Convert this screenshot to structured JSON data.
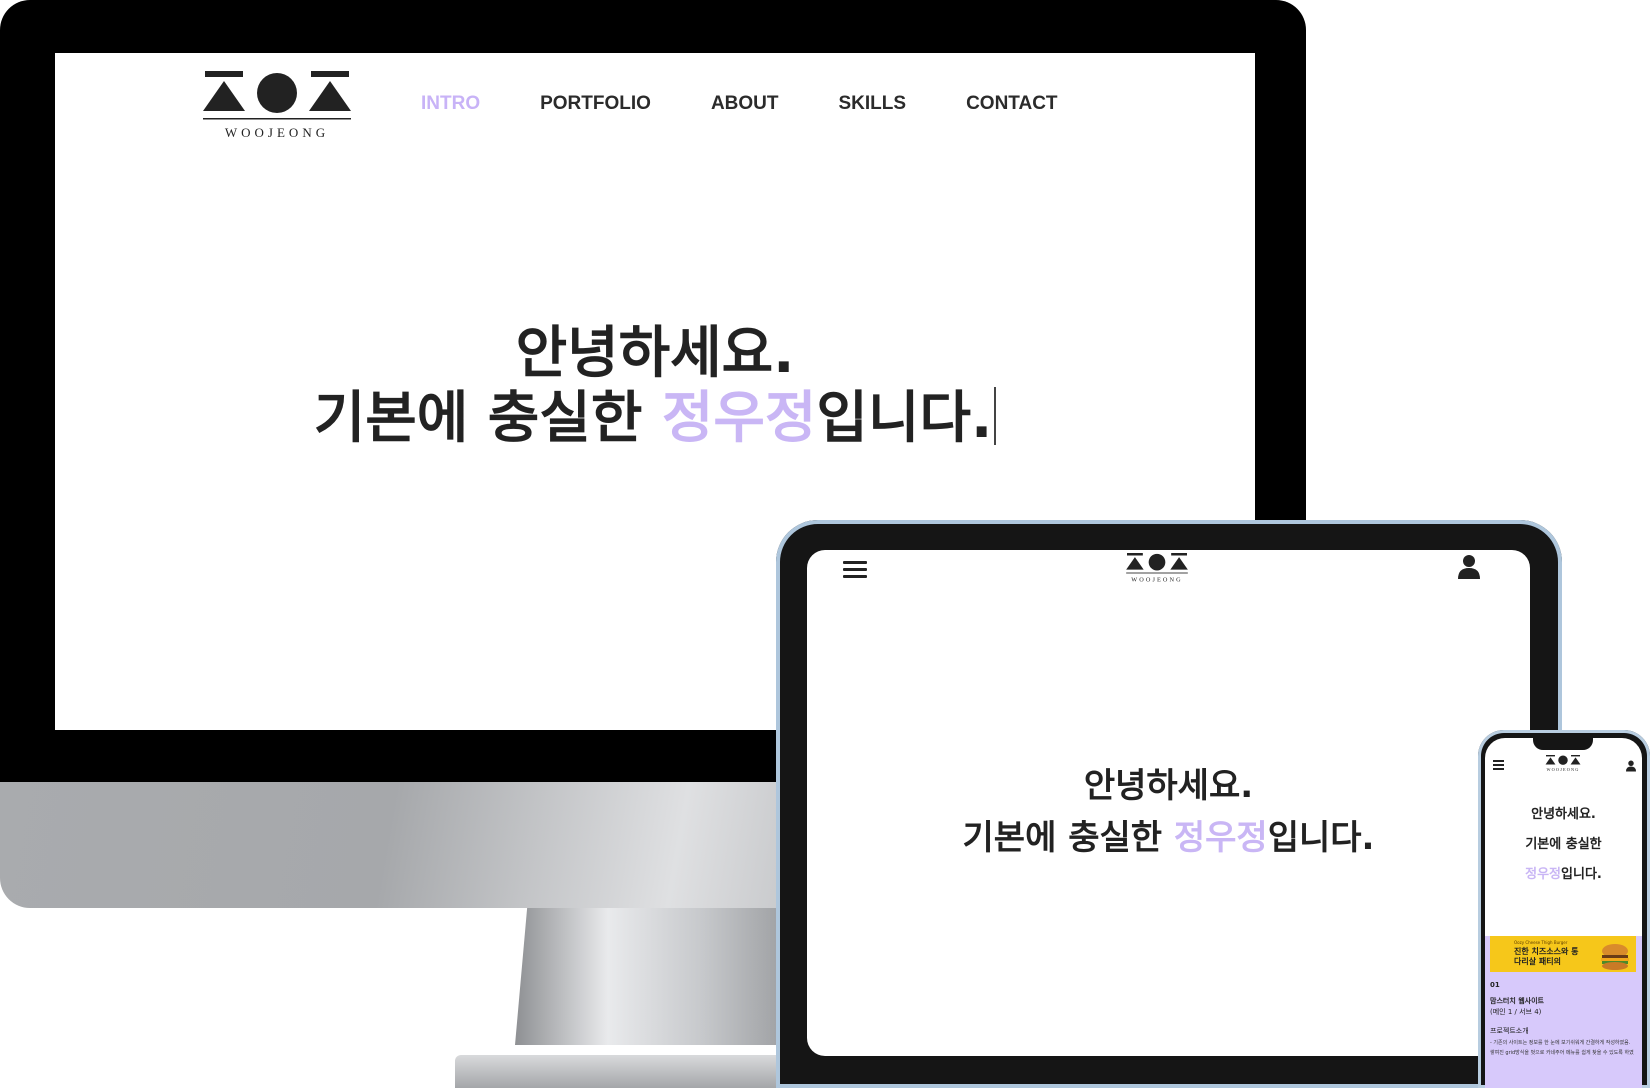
{
  "brand": {
    "logo_text": "WOOJEONG"
  },
  "desktop": {
    "nav": [
      "INTRO",
      "PORTFOLIO",
      "ABOUT",
      "SKILLS",
      "CONTACT"
    ],
    "hero": {
      "line1": "안녕하세요.",
      "line2_prefix": "기본에 충실한 ",
      "line2_name": "정우정",
      "line2_suffix": "입니다."
    }
  },
  "tablet": {
    "hero": {
      "line1": "안녕하세요.",
      "line2_prefix": "기본에 충실한 ",
      "line2_name": "정우정",
      "line2_suffix": "입니다."
    }
  },
  "phone": {
    "hero": {
      "line1": "안녕하세요.",
      "line2": "기본에 충실한",
      "line3_name": "정우정",
      "line3_suffix": "입니다."
    },
    "card": {
      "banner_small": "Oozy Cheese Thigh Burger",
      "banner_big": "진한 치즈소스와 통다리살 패티의",
      "number": "01",
      "title": "맘스터치 웹사이트",
      "subtitle": "(메인 1 / 서브 4)",
      "section": "프로젝트소개",
      "desc1": "- 기존의 사이트는 정보를 한 눈에 보기쉬워게 간결하게 작성하였음.",
      "desc2": "쌓여진 grid방식을 벗으로 카네주어 메뉴를 쉽게 찾을 수 있도록 하였"
    }
  },
  "colors": {
    "accent": "#c9b6f5",
    "text": "#222222",
    "card_bg": "#d7c9fb",
    "banner": "#f6c71a"
  }
}
